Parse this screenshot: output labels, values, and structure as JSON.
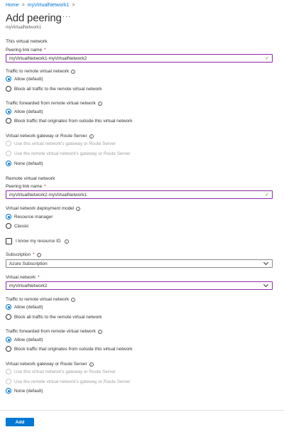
{
  "breadcrumb": {
    "home": "Home",
    "sep1": ">",
    "vnet": "myVirtualNetwork1",
    "sep2": ">"
  },
  "header": {
    "title": "Add peering",
    "more": "···",
    "subtitle": "myVirtualNetwork1"
  },
  "this_vnet": {
    "section": "This virtual network",
    "peering_label": "Peering link name",
    "peering_value": "myVirtualNetwork1-myVirtualNetwork2",
    "traffic_label": "Traffic to remote virtual network",
    "traffic_allow": "Allow (default)",
    "traffic_block": "Block all traffic to the remote virtual network",
    "forwarded_label": "Traffic forwarded from remote virtual network",
    "forwarded_allow": "Allow (default)",
    "forwarded_block": "Block traffic that originates from outside this virtual network",
    "gateway_label": "Virtual network gateway or Route Server",
    "gateway_use_this": "Use this virtual network's gateway or Route Server",
    "gateway_use_remote": "Use the remote virtual network's gateway or Route Server",
    "gateway_none": "None (default)"
  },
  "remote_vnet": {
    "section": "Remote virtual network",
    "peering_label": "Peering link name",
    "peering_value": "myVirtualNetwork2-myVirtualNetwork1",
    "model_label": "Virtual network deployment model",
    "model_rm": "Resource manager",
    "model_classic": "Classic",
    "resource_id_label": "I know my resource ID",
    "subscription_label": "Subscription",
    "subscription_value": "Azure Subscription",
    "vnet_label": "Virtual network",
    "vnet_value": "myVirtualNetwork2",
    "traffic_label": "Traffic to remote virtual network",
    "traffic_allow": "Allow (default)",
    "traffic_block": "Block all traffic to the remote virtual network",
    "forwarded_label": "Traffic forwarded from remote virtual network",
    "forwarded_allow": "Allow (default)",
    "forwarded_block": "Block traffic that originates from outside this virtual network",
    "gateway_label": "Virtual network gateway or Route Server",
    "gateway_use_this": "Use this virtual network's gateway or Route Server",
    "gateway_use_remote": "Use the remote virtual network's gateway or Route Server",
    "gateway_none": "None (default)"
  },
  "common": {
    "required_mark": "*",
    "info_glyph": "i",
    "check_glyph": "✓"
  },
  "footer": {
    "add_label": "Add"
  },
  "colors": {
    "accent": "#0078d4",
    "focus_border": "#8a2da5",
    "valid_check": "#57a300",
    "required": "#a4262c"
  }
}
